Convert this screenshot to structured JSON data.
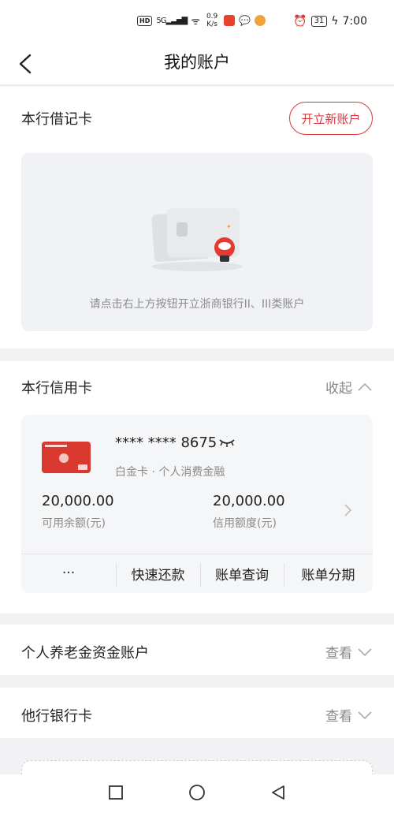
{
  "status_bar": {
    "hd": "HD",
    "signal": "5G",
    "speed": "0.9\nK/s",
    "battery": "31",
    "time": "7:00"
  },
  "nav": {
    "title": "我的账户",
    "back_icon": "back-icon"
  },
  "debit": {
    "title": "本行借记卡",
    "open_button": "开立新账户",
    "empty_tip": "请点击右上方按钮开立浙商银行II、III类账户"
  },
  "credit": {
    "title": "本行信用卡",
    "collapse_label": "收起",
    "card_number": "**** **** 8675",
    "card_type": "白金卡 · 个人消费金融",
    "available_amount": "20,000.00",
    "available_label": "可用余额(元)",
    "limit_amount": "20,000.00",
    "limit_label": "信用额度(元)",
    "actions": [
      "···",
      "快速还款",
      "账单查询",
      "账单分期"
    ]
  },
  "pension": {
    "title": "个人养老金资金账户",
    "view_label": "查看"
  },
  "other_bank": {
    "title": "他行银行卡",
    "view_label": "查看"
  },
  "colors": {
    "accent": "#d7363d",
    "background": "#f2f2f4"
  }
}
